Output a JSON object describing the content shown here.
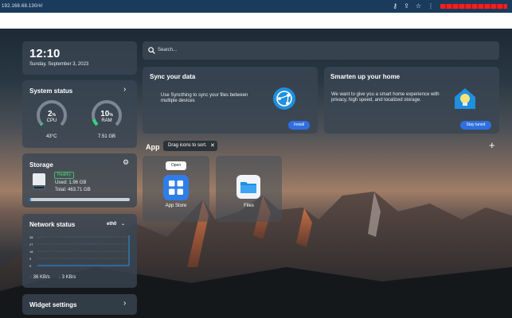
{
  "browser": {
    "url": "192.168.68.130/#/",
    "icons": [
      "key-icon",
      "share-icon",
      "star-icon",
      "menu-icon"
    ]
  },
  "clock": {
    "time": "12:10",
    "date": "Sunday, September 3, 2023"
  },
  "system_status": {
    "title": "System status",
    "cpu": {
      "value": "2",
      "unit": "%",
      "label": "CPU",
      "sub": "43°C",
      "percent": 2
    },
    "ram": {
      "value": "10",
      "unit": "%",
      "label": "RAM",
      "sub": "7.51 GB",
      "percent": 10
    }
  },
  "storage": {
    "title": "Storage",
    "badge": "Healthy",
    "used": "Used: 1.96 GB",
    "total": "Total: 463.71 GB",
    "used_fraction": 0.004
  },
  "network": {
    "title": "Network status",
    "interface": "eth0",
    "y_ticks": [
      "38",
      "27",
      "18",
      "9",
      "0"
    ],
    "upload": "36 KB/s",
    "download": "3 KB/s"
  },
  "widget_settings": {
    "title": "Widget settings"
  },
  "search": {
    "placeholder": "Search..."
  },
  "sync_card": {
    "title": "Sync your data",
    "text": "Use Syncthing to sync your files between multiple devices",
    "button": "Install"
  },
  "home_card": {
    "title": "Smarten up your home",
    "text": "We want to give you a smart home experience with privacy, high speed, and localized storage.",
    "button": "Stay tuned"
  },
  "apps": {
    "title": "App",
    "tooltip": "Drag icons to sort.",
    "open_tooltip": "Open",
    "items": [
      {
        "label": "App Store"
      },
      {
        "label": "Files"
      }
    ]
  },
  "colors": {
    "accent": "#2f6fe0",
    "gauge_green": "#2fd67a",
    "panel": "#3a4652",
    "browser_bar": "#1b3b5d",
    "healthy": "#3fbf6a",
    "network_line": "#2a8fe8"
  }
}
